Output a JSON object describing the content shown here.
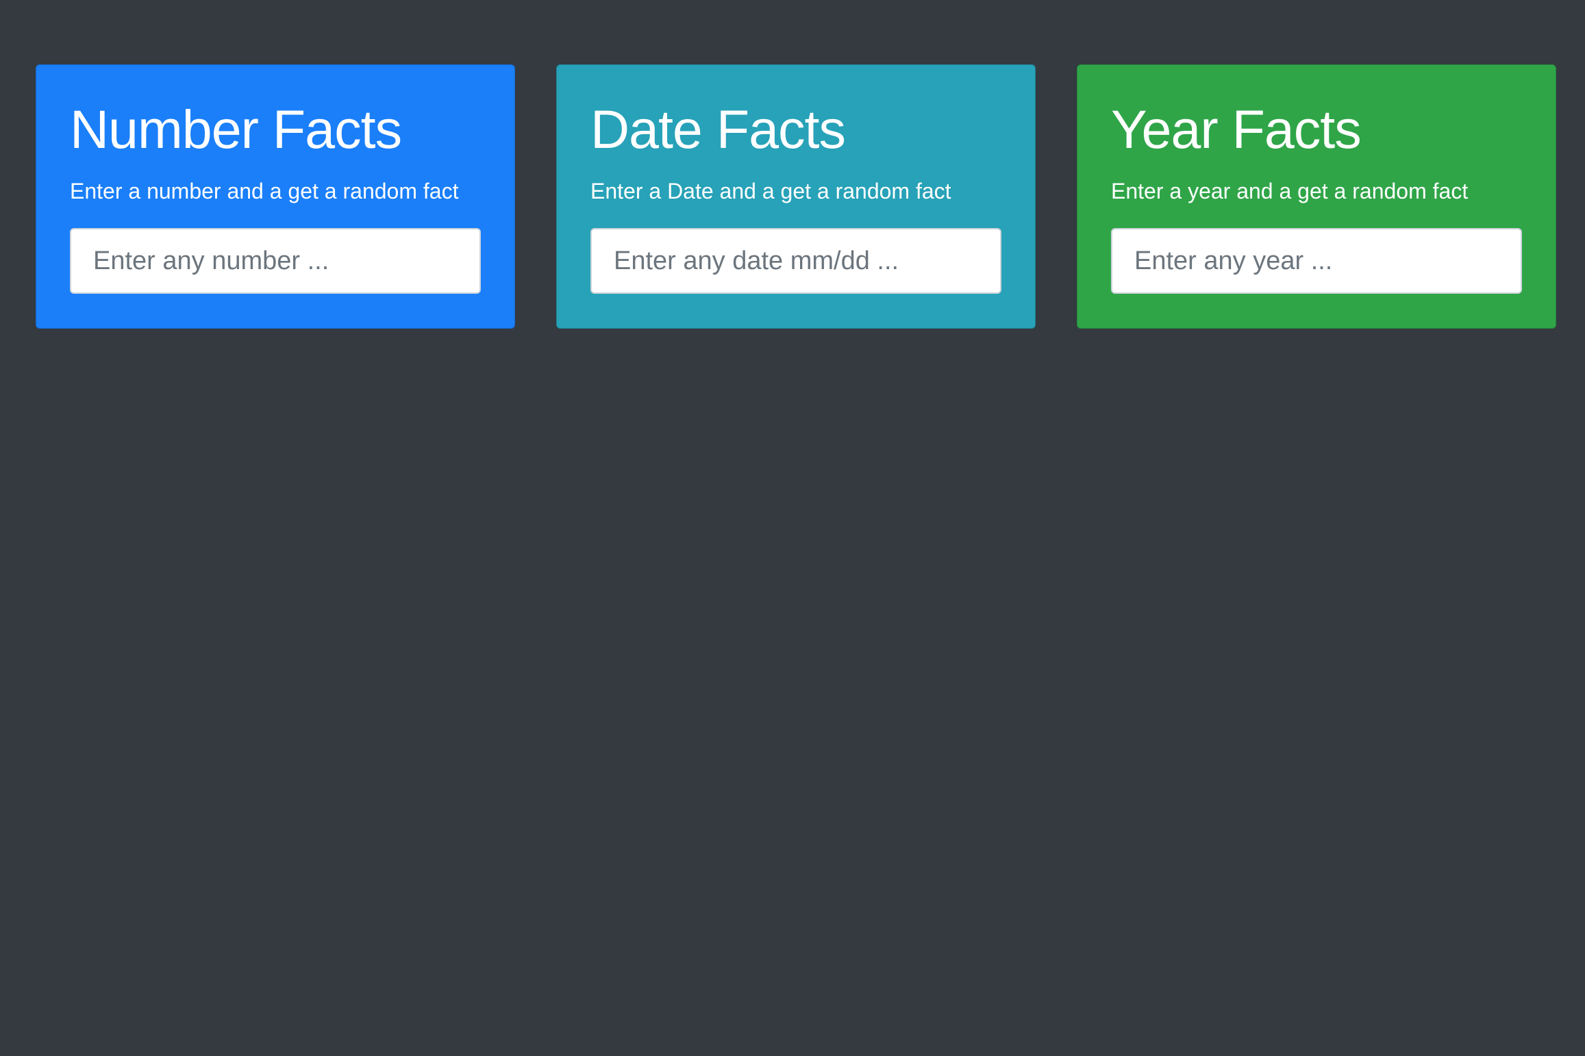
{
  "cards": [
    {
      "title": "Number Facts",
      "description": "Enter a number and a get a random fact",
      "placeholder": "Enter any number ...",
      "color": "#1a7ff9"
    },
    {
      "title": "Date Facts",
      "description": "Enter a Date and a get a random fact",
      "placeholder": "Enter any date mm/dd ...",
      "color": "#27a2b8"
    },
    {
      "title": "Year Facts",
      "description": "Enter a year and a get a random fact",
      "placeholder": "Enter any year ...",
      "color": "#2fa548"
    }
  ],
  "colors": {
    "page_background": "#343a40",
    "text": "#ffffff",
    "input_placeholder": "#6c757d"
  }
}
